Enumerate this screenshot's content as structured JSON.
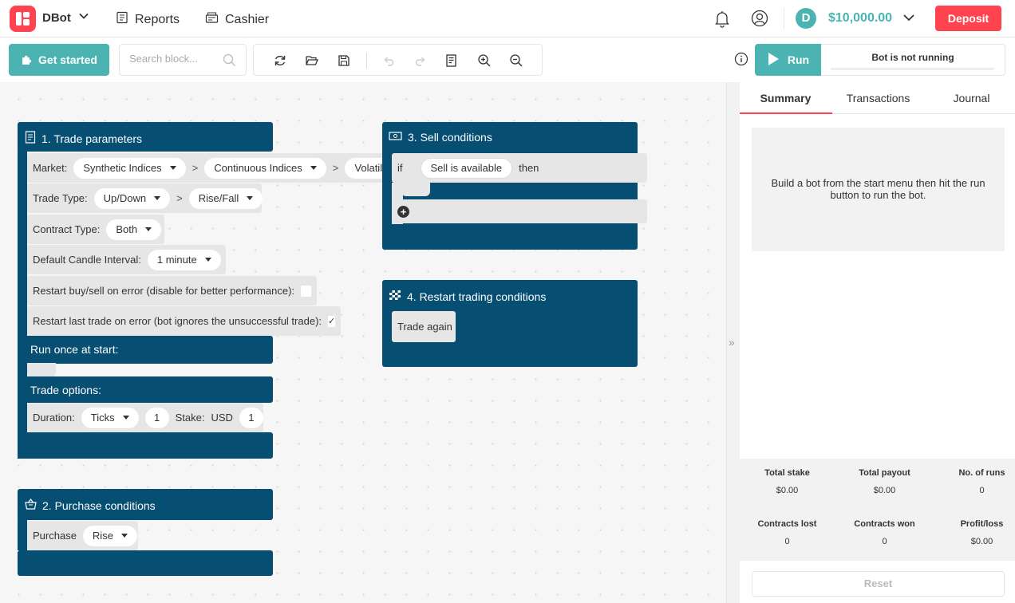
{
  "header": {
    "brand": "DBot",
    "nav": [
      {
        "label": "Reports",
        "icon": "reports-icon"
      },
      {
        "label": "Cashier",
        "icon": "cashier-icon"
      }
    ],
    "currency_symbol": "D",
    "balance": "$10,000.00",
    "deposit_label": "Deposit"
  },
  "toolbar": {
    "get_started_label": "Get started",
    "search_placeholder": "Search block...",
    "tools": [
      "reset-icon",
      "open-icon",
      "save-icon",
      "undo-icon",
      "redo-icon",
      "sort-icon",
      "zoom-in-icon",
      "zoom-out-icon"
    ],
    "run_label": "Run",
    "run_status": "Bot is not running"
  },
  "workspace": {
    "trade_parameters": {
      "title": "1. Trade parameters",
      "market_label": "Market:",
      "market_values": [
        "Synthetic Indices",
        "Continuous Indices",
        "Volatili"
      ],
      "chain_separator": ">",
      "trade_type_label": "Trade Type:",
      "trade_type_values": [
        "Up/Down",
        "Rise/Fall"
      ],
      "contract_type_label": "Contract Type:",
      "contract_type_value": "Both",
      "candle_label": "Default Candle Interval:",
      "candle_value": "1 minute",
      "restart_error_label": "Restart buy/sell on error (disable for better performance):",
      "restart_last_label": "Restart last trade on error (bot ignores the unsuccessful trade):",
      "restart_last_check": "✓",
      "run_once_label": "Run once at start:",
      "trade_options_label": "Trade options:",
      "duration_label": "Duration:",
      "duration_unit": "Ticks",
      "duration_value": "1",
      "stake_label": "Stake:",
      "stake_currency": "USD",
      "stake_value": "1"
    },
    "purchase_conditions": {
      "title": "2. Purchase conditions",
      "purchase_label": "Purchase",
      "purchase_value": "Rise"
    },
    "sell_conditions": {
      "title": "3. Sell conditions",
      "if_label": "if",
      "condition": "Sell is available",
      "then_label": "then",
      "plus": "+"
    },
    "restart_conditions": {
      "title": "4. Restart trading conditions",
      "action": "Trade again"
    },
    "collapse_glyph": "»"
  },
  "panel": {
    "tabs": [
      "Summary",
      "Transactions",
      "Journal"
    ],
    "active_tab": "Summary",
    "message": "Build a bot from the start menu then hit the run button to run the bot.",
    "stats": [
      {
        "label": "Total stake",
        "value": "$0.00"
      },
      {
        "label": "Total payout",
        "value": "$0.00"
      },
      {
        "label": "No. of runs",
        "value": "0"
      },
      {
        "label": "Contracts lost",
        "value": "0"
      },
      {
        "label": "Contracts won",
        "value": "0"
      },
      {
        "label": "Profit/loss",
        "value": "$0.00"
      }
    ],
    "reset_label": "Reset"
  },
  "colors": {
    "accent": "#4bb4b3",
    "brand_red": "#ff444f",
    "block_blue": "#064e72"
  }
}
